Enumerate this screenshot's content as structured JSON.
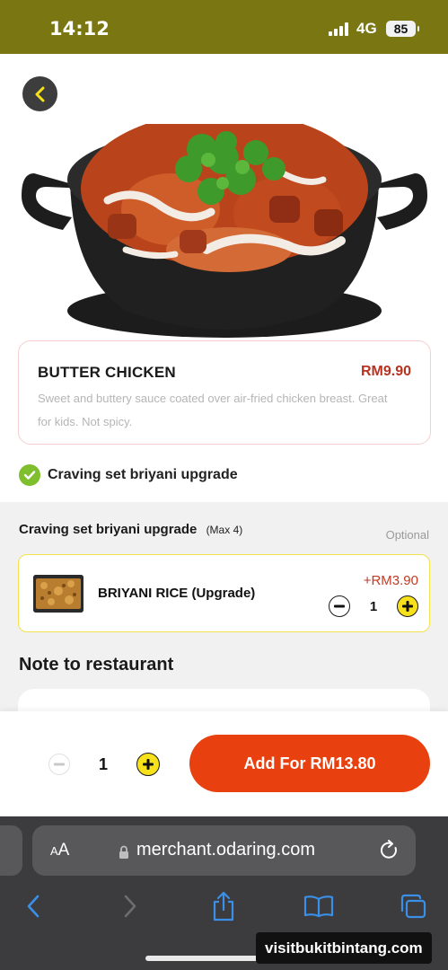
{
  "status_bar": {
    "time": "14:12",
    "network": "4G",
    "battery": "85"
  },
  "product": {
    "name": "BUTTER CHICKEN",
    "price": "RM9.90",
    "description": "Sweet and buttery sauce coated over air-fried chicken breast. Great for kids. Not spicy."
  },
  "selected_option": {
    "label": "Craving set briyani upgrade"
  },
  "option_group": {
    "title": "Craving set briyani upgrade",
    "max": "(Max 4)",
    "optional": "Optional",
    "items": [
      {
        "name": "BRIYANI RICE (Upgrade)",
        "price": "+RM3.90",
        "quantity": "1"
      }
    ]
  },
  "note": {
    "title": "Note to restaurant"
  },
  "order": {
    "quantity": "1",
    "add_button": "Add For RM13.80"
  },
  "browser": {
    "text_size": "AA",
    "url": "merchant.odaring.com"
  },
  "watermark": "visitbukitbintang.com",
  "colors": {
    "accent": "#e8400e",
    "price": "#b8321f",
    "plus": "#f7e11a",
    "check": "#7fbf2e",
    "status_bar": "#7a7612"
  }
}
